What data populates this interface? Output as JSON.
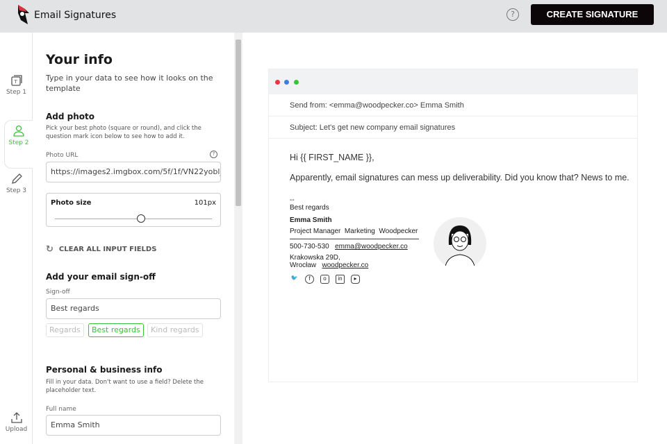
{
  "header": {
    "title": "Email Signatures",
    "help_icon": "question-circle-icon",
    "create_label": "CREATE SIGNATURE"
  },
  "rail": {
    "steps": [
      {
        "label": "Step 1",
        "icon": "template-icon"
      },
      {
        "label": "Step 2",
        "icon": "user-icon"
      },
      {
        "label": "Step 3",
        "icon": "pencil-icon"
      }
    ],
    "upload": "Upload",
    "active_color": "#3cc13b"
  },
  "panel": {
    "title": "Your info",
    "subtitle": "Type in your data to see how it looks on the template",
    "photo": {
      "heading": "Add photo",
      "hint": "Pick your best photo (square or round), and click the question mark icon below to see how to add it.",
      "url_label": "Photo URL",
      "url_value": "https://images2.imgbox.com/5f/1f/VN22yobl_",
      "size_label": "Photo size",
      "size_value": "101px",
      "size_fraction": 0.55
    },
    "clear_label": "CLEAR ALL INPUT FIELDS",
    "signoff": {
      "heading": "Add your email sign-off",
      "label": "Sign-off",
      "value": "Best regards",
      "options": [
        "Regards",
        "Best regards",
        "Kind regards"
      ],
      "selected": "Best regards"
    },
    "personal": {
      "heading": "Personal & business info",
      "hint": "Fill in your data. Don't want to use a field? Delete the placeholder text.",
      "fullname_label": "Full name",
      "fullname_value": "Emma Smith"
    }
  },
  "preview": {
    "from": "Send from: <emma@woodpecker.co> Emma Smith",
    "subject": "Subject: Let's get new company email signatures",
    "greeting": "Hi {{ FIRST_NAME }},",
    "message": "Apparently, email signatures can mess up deliverability. Did you know that? News to me.",
    "sig": {
      "dashes": "--",
      "signoff": "Best regards",
      "name": "Emma Smith",
      "role": "Project Manager  Marketing  Woodpecker",
      "phone": "500-730-530",
      "email": "emma@woodpecker.co",
      "address": "Krakowska 29D, Wrocław",
      "website": "woodpecker.co",
      "social": [
        "twitter-icon",
        "facebook-icon",
        "instagram-icon",
        "linkedin-icon",
        "youtube-icon"
      ]
    },
    "dots": [
      "#ee3344",
      "#3d7fe0",
      "#3cc13b"
    ]
  }
}
